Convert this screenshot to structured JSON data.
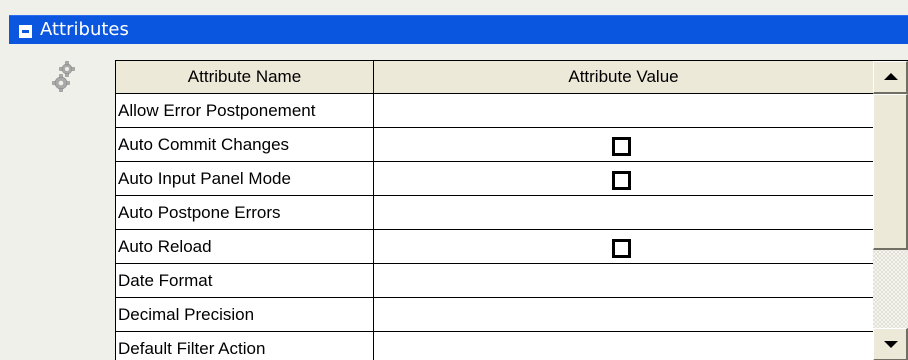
{
  "section": {
    "title": "Attributes",
    "collapse_icon": "minus-box-icon"
  },
  "toolbar": {
    "icon": "gear-icon"
  },
  "grid": {
    "columns": [
      "Attribute Name",
      "Attribute Value"
    ],
    "rows": [
      {
        "name": "Allow Error Postponement",
        "value": "",
        "checkbox": false
      },
      {
        "name": "Auto Commit Changes",
        "value": "",
        "checkbox": true,
        "checked": false
      },
      {
        "name": "Auto Input Panel Mode",
        "value": "",
        "checkbox": true,
        "checked": false
      },
      {
        "name": "Auto Postpone Errors",
        "value": "",
        "checkbox": false
      },
      {
        "name": "Auto Reload",
        "value": "",
        "checkbox": true,
        "checked": false
      },
      {
        "name": "Date Format",
        "value": "",
        "checkbox": false
      },
      {
        "name": "Decimal Precision",
        "value": "",
        "checkbox": false
      },
      {
        "name": "Default Filter Action",
        "value": "",
        "checkbox": false
      }
    ]
  },
  "scrollbar": {
    "up_icon": "arrow-up-icon",
    "down_icon": "arrow-down-icon"
  },
  "colors": {
    "header_bg": "#0a56df",
    "header_text": "#ffffff",
    "panel_bg": "#f0f0ea",
    "column_header_bg": "#ece9d8"
  }
}
